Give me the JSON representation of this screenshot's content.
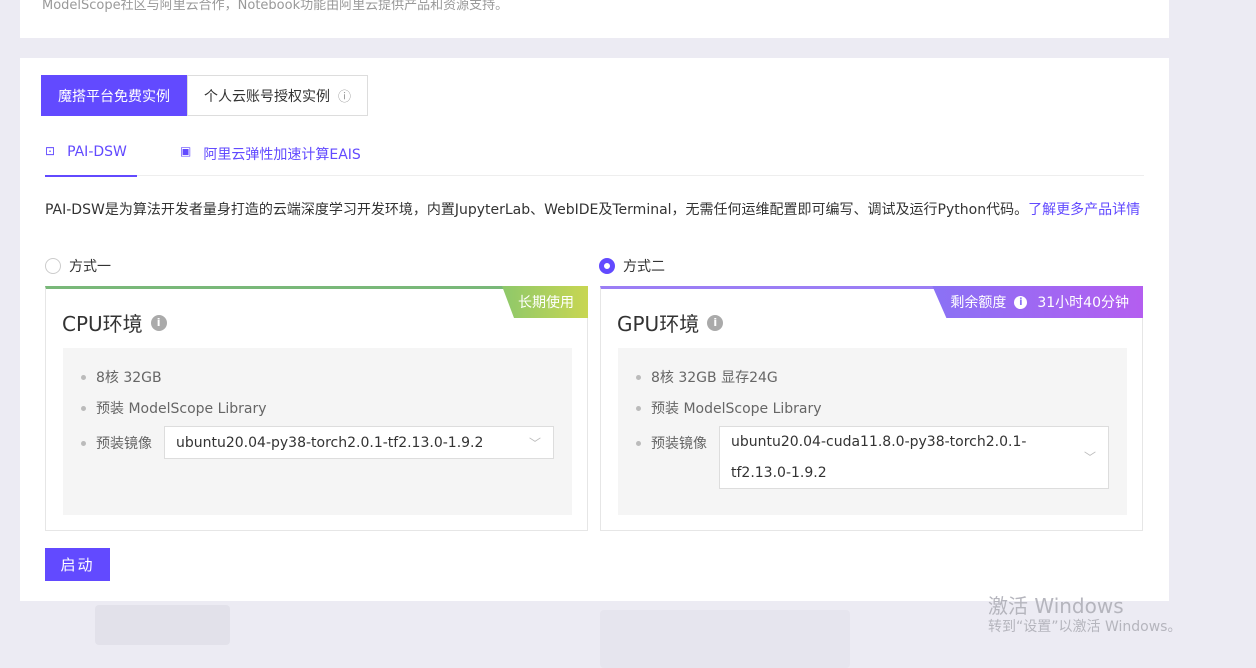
{
  "top_note": "ModelScope社区与阿里云合作，Notebook功能由阿里云提供产品和资源支持。",
  "segment": {
    "free_label": "魔搭平台免费实例",
    "personal_label": "个人云账号授权实例",
    "info_icon": "info-circle-icon"
  },
  "tabs": [
    {
      "label": "PAI-DSW",
      "icon": "dsw-icon"
    },
    {
      "label": "阿里云弹性加速计算EAIS",
      "icon": "chip-icon"
    }
  ],
  "description": {
    "text": "PAI-DSW是为算法开发者量身打造的云端深度学习开发环境，内置JupyterLab、WebIDE及Terminal，无需任何运维配置即可编写、调试及运行Python代码。",
    "link": "了解更多产品详情"
  },
  "option1": {
    "radio_label": "方式一",
    "checked": false,
    "title": "CPU环境",
    "badge": "长期使用",
    "specs": [
      "8核 32GB",
      "预装 ModelScope Library"
    ],
    "image_label": "预装镜像",
    "image_value": "ubuntu20.04-py38-torch2.0.1-tf2.13.0-1.9.2"
  },
  "option2": {
    "radio_label": "方式二",
    "checked": true,
    "title": "GPU环境",
    "badge_label": "剩余额度",
    "badge_time": "31小时40分钟",
    "specs": [
      "8核 32GB 显存24G",
      "预装 ModelScope Library"
    ],
    "image_label": "预装镜像",
    "image_value": "ubuntu20.04-cuda11.8.0-py38-torch2.0.1-tf2.13.0-1.9.2"
  },
  "start_button": "启动",
  "watermark": {
    "line1": "激活 Windows",
    "line2": "转到“设置”以激活 Windows。"
  },
  "colors": {
    "accent": "#624aff",
    "cpu_bar": "#79b879",
    "gpu_bar": "#9b7ef5"
  }
}
